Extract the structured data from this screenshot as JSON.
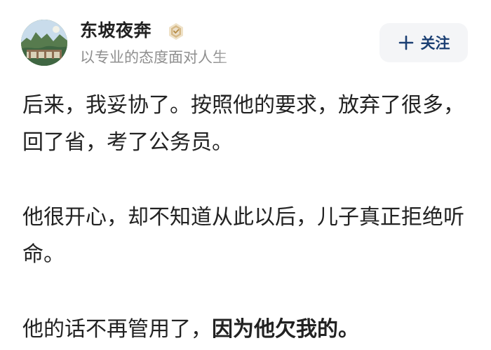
{
  "author": {
    "name": "东坡夜奔",
    "bio": "以专业的态度面对人生",
    "avatar_icon": "landscape-avatar-icon",
    "verify_icon": "gold-verified-icon"
  },
  "actions": {
    "follow_label": "关注",
    "follow_icon": "plus-icon",
    "accent_color": "#1b3f73"
  },
  "post": {
    "paragraphs": [
      {
        "text": "后来，我妥协了。按照他的要求，放弃了很多，回了省，考了公务员。"
      },
      {
        "text": "他很开心，却不知道从此以后，儿子真正拒绝听命。"
      },
      {
        "text_before": "他的话不再管用了，",
        "text_bold": "因为他欠我的。"
      }
    ]
  }
}
